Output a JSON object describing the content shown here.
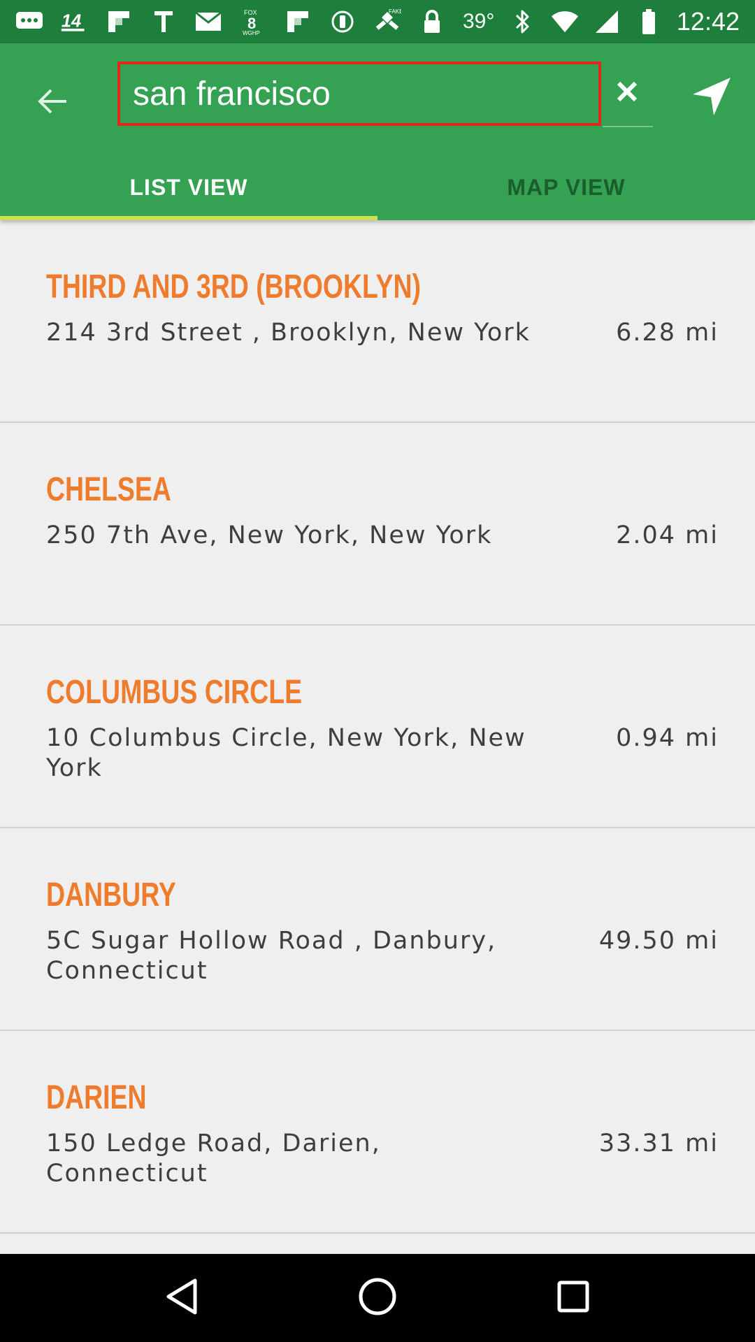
{
  "status_bar": {
    "icons": [
      "messages-icon",
      "channel-14-icon",
      "flipboard-icon",
      "text-app-icon",
      "gmail-icon",
      "fox8-icon",
      "flipboard-icon",
      "pandora-icon",
      "fake-gps-icon",
      "lock-icon"
    ],
    "temperature": "39°",
    "time": "12:42"
  },
  "toolbar": {
    "search_value": "san francisco",
    "search_placeholder": "",
    "tabs": [
      {
        "label": "LIST VIEW",
        "active": true
      },
      {
        "label": "MAP VIEW",
        "active": false
      }
    ]
  },
  "locations": [
    {
      "name": "THIRD AND 3RD (BROOKLYN)",
      "address": "214 3rd Street , Brooklyn, New York",
      "distance": "6.28 mi"
    },
    {
      "name": "CHELSEA",
      "address": "250 7th Ave, New York, New York",
      "distance": "2.04 mi"
    },
    {
      "name": "COLUMBUS CIRCLE",
      "address": "10 Columbus Circle, New York, New York",
      "distance": "0.94 mi"
    },
    {
      "name": "DANBURY",
      "address": "5C Sugar Hollow Road , Danbury, Connecticut",
      "distance": "49.50 mi"
    },
    {
      "name": "DARIEN",
      "address": "150 Ledge Road, Darien, Connecticut",
      "distance": "33.31 mi"
    }
  ],
  "colors": {
    "status_bar": "#1e7e3c",
    "toolbar": "#34a153",
    "tab_indicator": "#cde04a",
    "location_name": "#ef7b2d",
    "search_border": "#e0281e"
  }
}
